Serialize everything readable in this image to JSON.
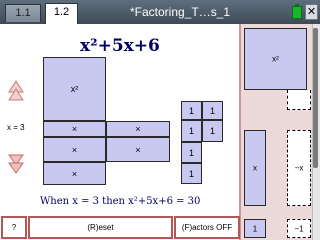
{
  "tabs": [
    {
      "label": "1.1"
    },
    {
      "label": "1.2"
    }
  ],
  "document_title": "*Factoring_T…s_1",
  "close_label": "✕",
  "expression_title": "x²+5x+6",
  "x_value_label": "x = 3",
  "tiles": {
    "x2": "x²",
    "x": "×",
    "one": "1"
  },
  "result_text": "When x = 3 then x²+5x+6 = 30",
  "buttons": {
    "help": "?",
    "reset": "(R)eset",
    "factors": "(F)actors OFF"
  },
  "palette": {
    "x2_tile": "x²",
    "x_tile": "x",
    "neg_x_tile": "−x",
    "one_tile": "1",
    "neg_one_tile": "−1"
  },
  "colors": {
    "tile": "#c8c8f0",
    "button_border": "#b35858",
    "panel": "#ecd9d9",
    "arrow_up": "#d9a3a3",
    "arrow_down": "#d48a8a"
  }
}
